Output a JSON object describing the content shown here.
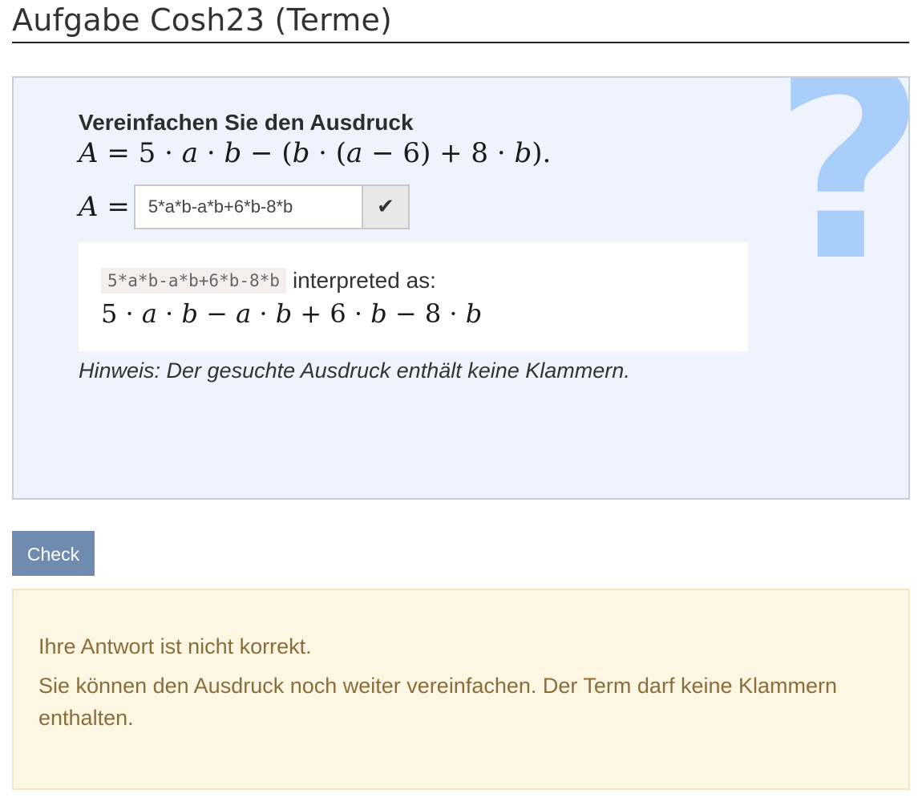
{
  "page_title": "Aufgabe Cosh23 (Terme)",
  "question": {
    "decoration_icon": "question-mark-icon",
    "prompt": "Vereinfachen Sie den Ausdruck",
    "answer_value": "5*a*b-a*b+6*b-8*b",
    "validate_icon": "checkmark-icon",
    "interpretation": {
      "input_echo": "5*a*b-a*b+6*b-8*b",
      "label": "interpreted as:"
    },
    "hint": "Hinweis: Der gesuchte Ausdruck enthält keine Klammern."
  },
  "check_button_label": "Check",
  "feedback": {
    "line1": "Ihre Antwort ist nicht korrekt.",
    "line2": "Sie können den Ausdruck noch weiter vereinfachen. Der Term darf keine Klammern enthalten."
  },
  "colors": {
    "question_bg": "#eef3fd",
    "question_mark": "#a9cef9",
    "check_button": "#6f8cb0",
    "feedback_bg": "#fcf6e2",
    "feedback_text": "#8a6d3b"
  }
}
